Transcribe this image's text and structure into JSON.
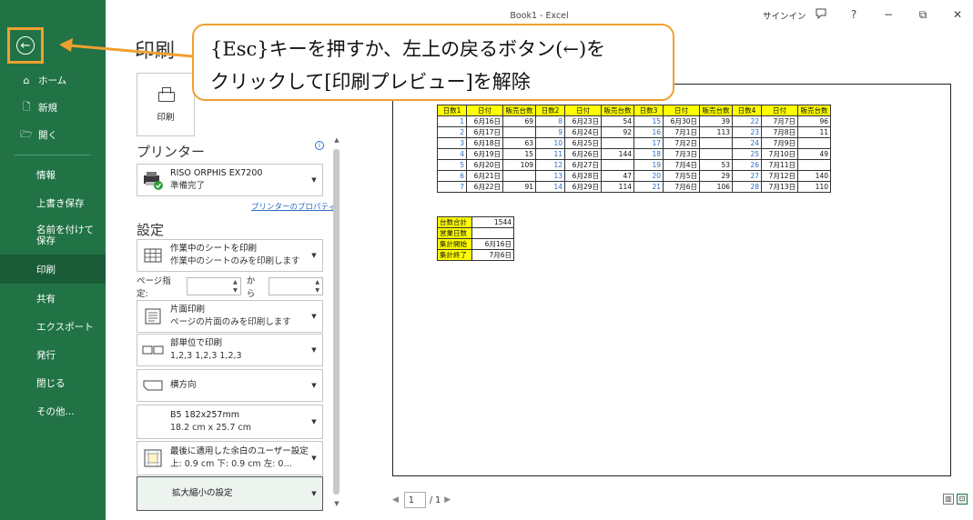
{
  "window": {
    "title": "Book1  -  Excel",
    "signin": "サインイン",
    "controls": [
      "feedback-icon",
      "help-icon",
      "minimize-icon",
      "restore-icon",
      "close-icon"
    ],
    "help_glyph": "?",
    "minimize_glyph": "−",
    "restore_glyph": "⧉",
    "close_glyph": "✕"
  },
  "sidebar": {
    "back_glyph": "←",
    "top_items": [
      {
        "label": "ホーム",
        "icon": "home-icon",
        "glyph": "⌂"
      },
      {
        "label": "新規",
        "icon": "new-doc-icon",
        "glyph": "🗋"
      },
      {
        "label": "開く",
        "icon": "open-folder-icon",
        "glyph": "🗁"
      }
    ],
    "items": [
      {
        "label": "情報"
      },
      {
        "label": "上書き保存"
      },
      {
        "label": "名前を付けて保存"
      },
      {
        "label": "印刷",
        "active": true
      },
      {
        "label": "共有"
      },
      {
        "label": "エクスポート"
      },
      {
        "label": "発行"
      },
      {
        "label": "閉じる"
      },
      {
        "label": "その他..."
      }
    ]
  },
  "print": {
    "title": "印刷",
    "print_button": "印刷",
    "printer_heading": "プリンター",
    "printer_name": "RISO ORPHIS EX7200",
    "printer_status": "準備完了",
    "printer_properties": "プリンターのプロパティ",
    "settings_heading": "設定",
    "settings": [
      {
        "line1": "作業中のシートを印刷",
        "line2": "作業中のシートのみを印刷します",
        "icon": "sheet-grid-icon"
      },
      {
        "line1": "片面印刷",
        "line2": "ページの片面のみを印刷します",
        "icon": "one-sided-icon"
      },
      {
        "line1": "部単位で印刷",
        "line2": "1,2,3    1,2,3    1,2,3",
        "icon": "collate-icon"
      },
      {
        "line1": "横方向",
        "line2": "",
        "icon": "landscape-icon"
      },
      {
        "line1": "B5 182x257mm",
        "line2": "18.2 cm x 25.7 cm",
        "icon": "paper-size-icon"
      },
      {
        "line1": "最後に適用した余白のユーザー設定",
        "line2": "上: 0.9 cm 下: 0.9 cm 左: 0…",
        "icon": "margins-icon"
      },
      {
        "line1": "拡大縮小の設定",
        "line2": "",
        "icon": "",
        "highlight": true
      }
    ],
    "pages_label": "ページ指定:",
    "pages_to": "から",
    "pages_from_value": "",
    "pages_to_value": ""
  },
  "callout": {
    "line1": "{Esc}キーを押すか、左上の戻るボタン(←)を",
    "line2": "クリックして[印刷プレビュー]を解除"
  },
  "preview": {
    "main_table": {
      "header": [
        "日数1",
        "日付",
        "販売台数",
        "日数2",
        "日付",
        "販売台数",
        "日数3",
        "日付",
        "販売台数",
        "日数4",
        "日付",
        "販売台数"
      ],
      "rows": [
        [
          "1",
          "6月16日",
          "69",
          "8",
          "6月23日",
          "54",
          "15",
          "6月30日",
          "39",
          "22",
          "7月7日",
          "96"
        ],
        [
          "2",
          "6月17日",
          "",
          "9",
          "6月24日",
          "92",
          "16",
          "7月1日",
          "113",
          "23",
          "7月8日",
          "11"
        ],
        [
          "3",
          "6月18日",
          "63",
          "10",
          "6月25日",
          "",
          "17",
          "7月2日",
          "",
          "24",
          "7月9日",
          ""
        ],
        [
          "4",
          "6月19日",
          "15",
          "11",
          "6月26日",
          "144",
          "18",
          "7月3日",
          "",
          "25",
          "7月10日",
          "49"
        ],
        [
          "5",
          "6月20日",
          "109",
          "12",
          "6月27日",
          "",
          "19",
          "7月4日",
          "53",
          "26",
          "7月11日",
          ""
        ],
        [
          "6",
          "6月21日",
          "",
          "13",
          "6月28日",
          "47",
          "20",
          "7月5日",
          "29",
          "27",
          "7月12日",
          "140"
        ],
        [
          "7",
          "6月22日",
          "91",
          "14",
          "6月29日",
          "114",
          "21",
          "7月6日",
          "106",
          "28",
          "7月13日",
          "110"
        ]
      ]
    },
    "summary_table": [
      [
        "台数合計",
        "1544"
      ],
      [
        "営業日数",
        ""
      ],
      [
        "集計開始",
        "6月16日"
      ],
      [
        "集計終了",
        "7月6日"
      ]
    ],
    "page_current": "1",
    "page_total": "/ 1"
  }
}
